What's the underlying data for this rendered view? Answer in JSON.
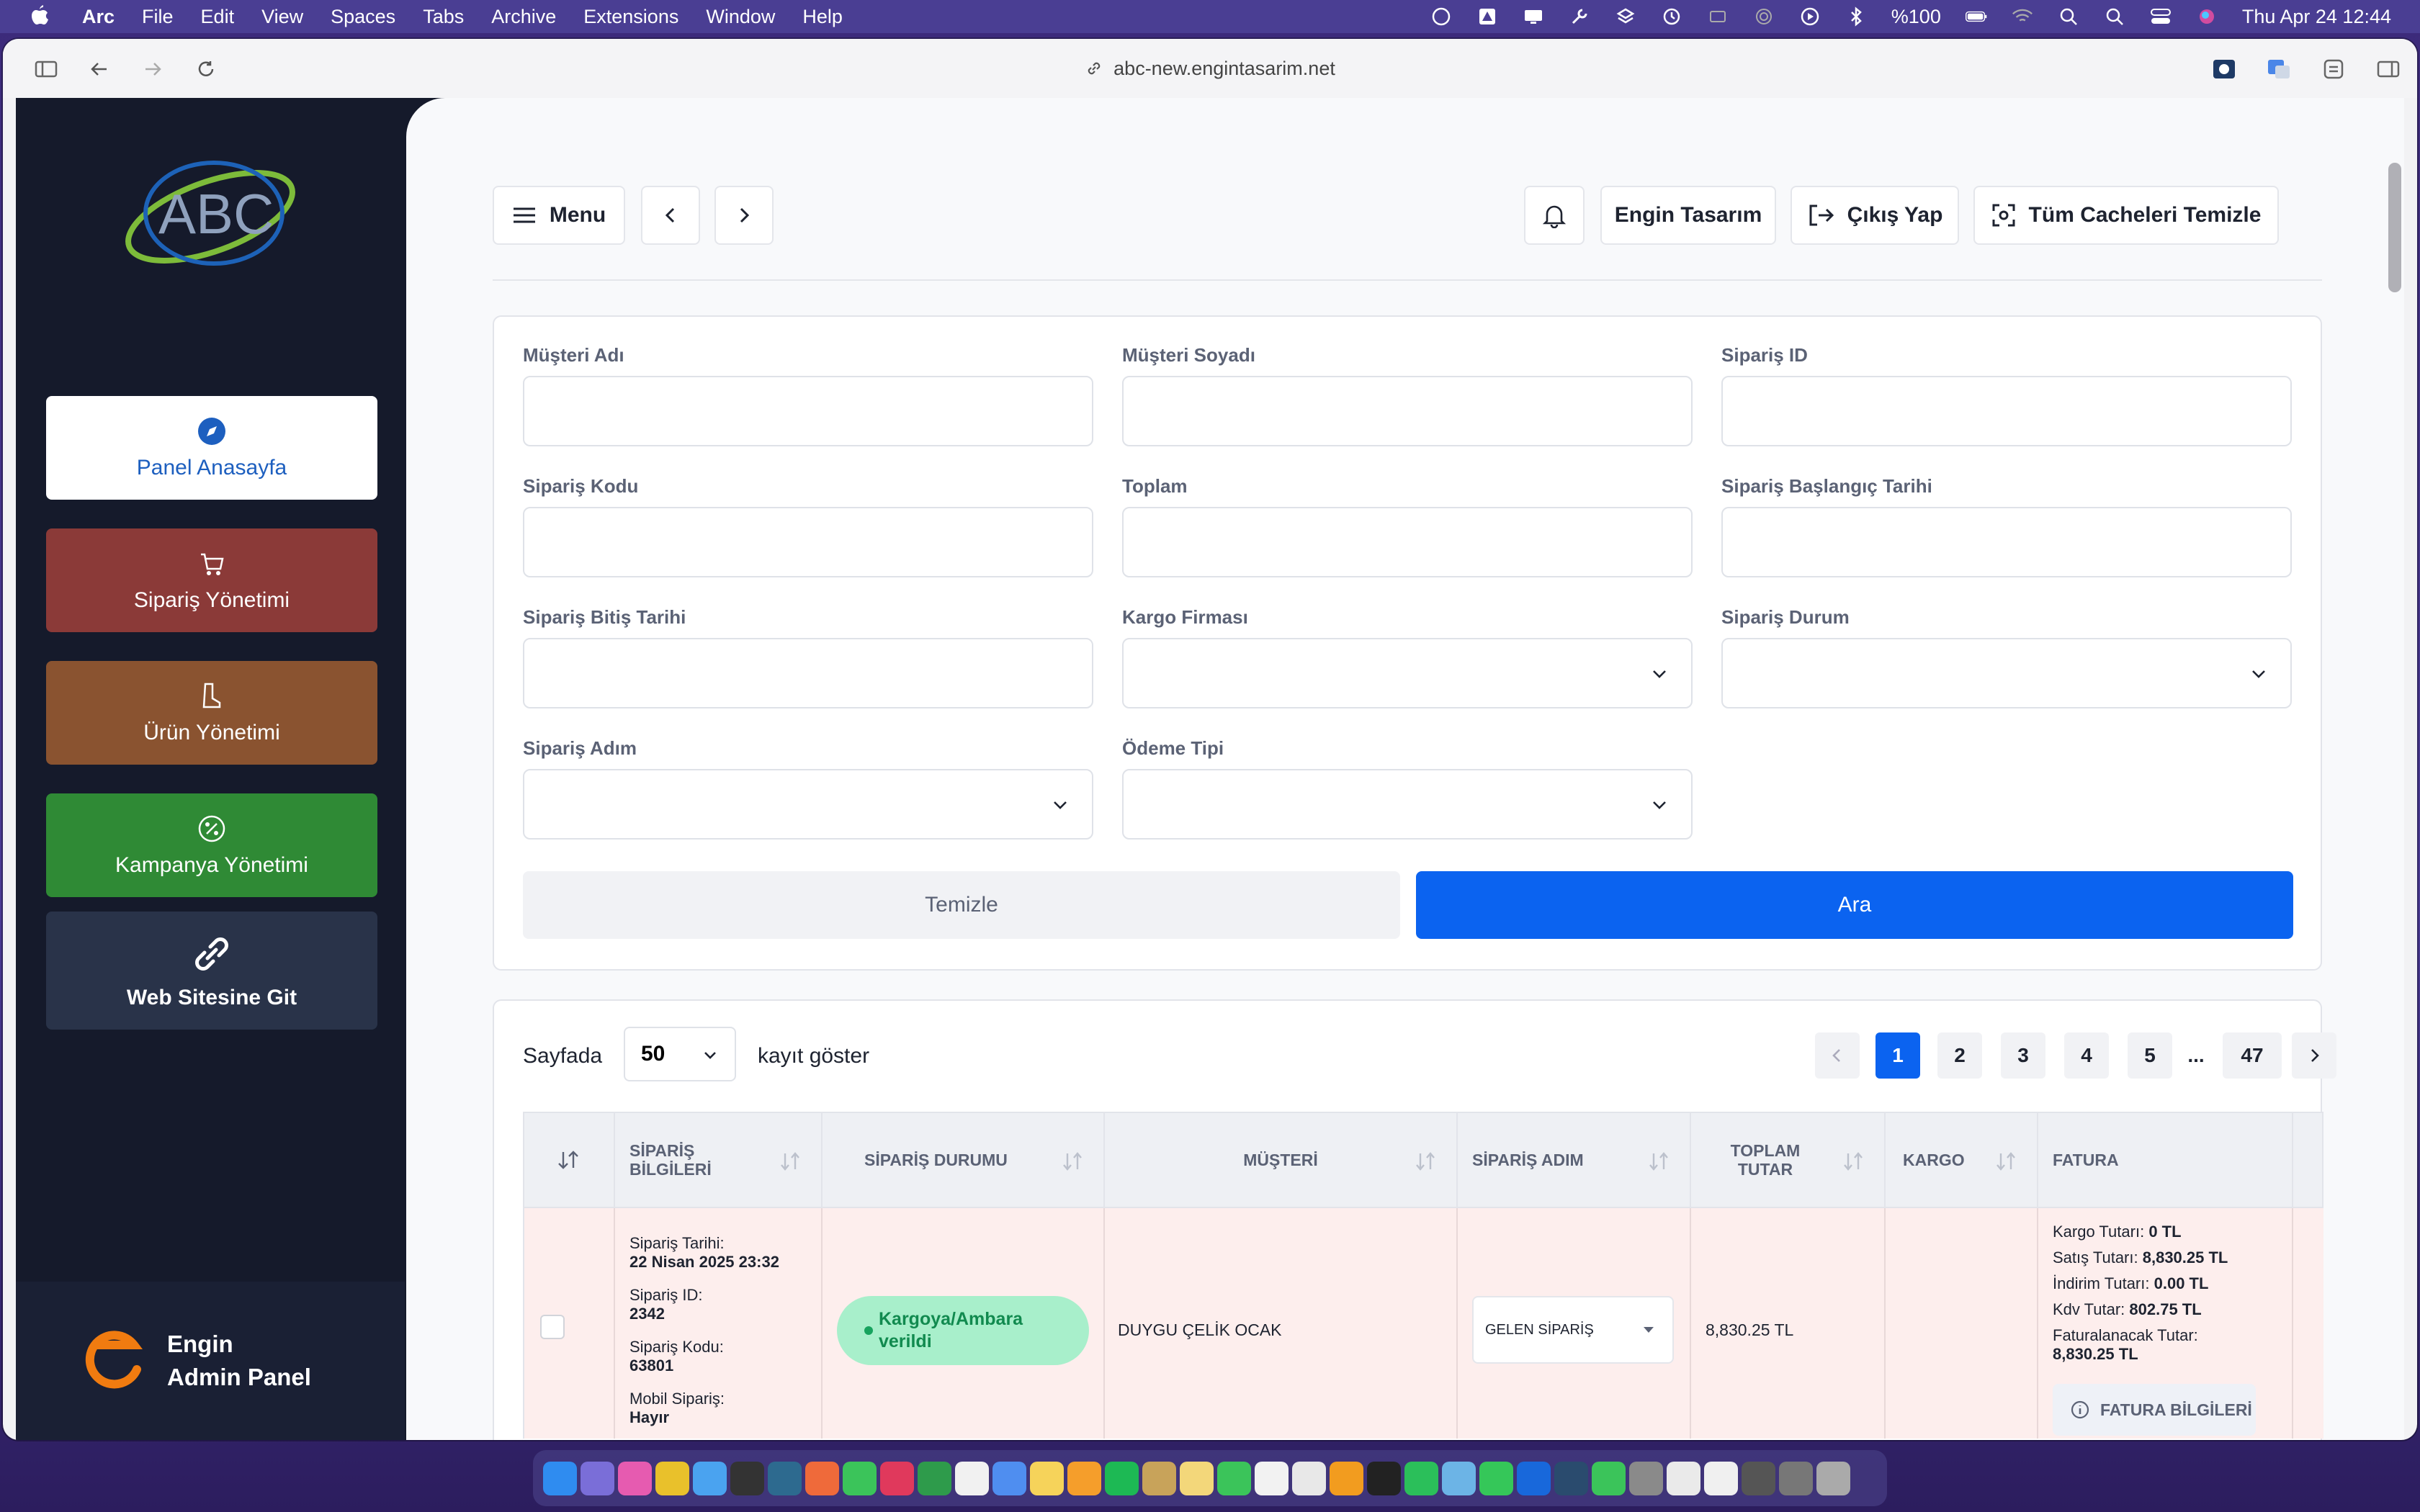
{
  "menubar": {
    "app": "Arc",
    "items": [
      "File",
      "Edit",
      "View",
      "Spaces",
      "Tabs",
      "Archive",
      "Extensions",
      "Window",
      "Help"
    ],
    "battery": "%100",
    "clock": "Thu Apr 24  12:44"
  },
  "browser": {
    "url": "abc-new.engintasarim.net"
  },
  "sidebar": {
    "items": [
      {
        "label": "Panel Anasayfa",
        "icon": "compass-icon",
        "color": "#ffffff",
        "text_color": "#1d5fbf"
      },
      {
        "label": "Sipariş Yönetimi",
        "icon": "cart-icon",
        "color": "#8b3a38",
        "text_color": "#ffffff"
      },
      {
        "label": "Ürün Yönetimi",
        "icon": "boot-icon",
        "color": "#8a5330",
        "text_color": "#ffffff"
      },
      {
        "label": "Kampanya Yönetimi",
        "icon": "discount-icon",
        "color": "#2f8a35",
        "text_color": "#ffffff"
      },
      {
        "label": "Web Sitesine Git",
        "icon": "link-icon",
        "color": "#293349",
        "text_color": "#ffffff"
      }
    ],
    "footer": {
      "line1": "Engin",
      "line2": "Admin Panel"
    }
  },
  "topbar": {
    "menu_label": "Menu",
    "user_label": "Engin Tasarım",
    "logout_label": "Çıkış Yap",
    "clear_cache_label": "Tüm Cacheleri Temizle"
  },
  "filters": {
    "fields": [
      {
        "label": "Müşteri Adı",
        "type": "text",
        "value": ""
      },
      {
        "label": "Müşteri Soyadı",
        "type": "text",
        "value": ""
      },
      {
        "label": "Sipariş ID",
        "type": "text",
        "value": ""
      },
      {
        "label": "Sipariş Kodu",
        "type": "text",
        "value": ""
      },
      {
        "label": "Toplam",
        "type": "text",
        "value": ""
      },
      {
        "label": "Sipariş Başlangıç Tarihi",
        "type": "text",
        "value": ""
      },
      {
        "label": "Sipariş Bitiş Tarihi",
        "type": "text",
        "value": ""
      },
      {
        "label": "Kargo Firması",
        "type": "select",
        "value": ""
      },
      {
        "label": "Sipariş Durum",
        "type": "select",
        "value": ""
      },
      {
        "label": "Sipariş Adım",
        "type": "select",
        "value": ""
      },
      {
        "label": "Ödeme Tipi",
        "type": "select",
        "value": ""
      }
    ],
    "clear_label": "Temizle",
    "search_label": "Ara"
  },
  "table": {
    "page_prefix": "Sayfada",
    "page_size": "50",
    "page_suffix": "kayıt göster",
    "pages": [
      "1",
      "2",
      "3",
      "4",
      "5",
      "...",
      "47"
    ],
    "current_page": "1",
    "columns": [
      "SİPARİŞ BİLGİLERİ",
      "SİPARİŞ DURUMU",
      "MÜŞTERİ",
      "SİPARİŞ ADIM",
      "TOPLAM TUTAR",
      "KARGO",
      "FATURA"
    ],
    "rows": [
      {
        "date_label": "Sipariş Tarihi:",
        "date": "22 Nisan 2025 23:32",
        "id_label": "Sipariş ID:",
        "id": "2342",
        "code_label": "Sipariş Kodu:",
        "code": "63801",
        "mobile_label": "Mobil Sipariş:",
        "mobile": "Hayır",
        "status": "Kargoya/Ambara verildi",
        "customer": "DUYGU ÇELİK OCAK",
        "step": "GELEN SİPARİŞ",
        "total": "8,830.25 TL",
        "kargo_tutar_label": "Kargo Tutarı:",
        "kargo_tutar": "0 TL",
        "satis_tutar_label": "Satış Tutarı:",
        "satis_tutar": "8,830.25 TL",
        "indirim_label": "İndirim Tutarı:",
        "indirim": "0.00 TL",
        "kdv_label": "Kdv Tutar:",
        "kdv": "802.75 TL",
        "faturalanacak_label": "Faturalanacak Tutar:",
        "faturalanacak": "8,830.25 TL",
        "fatura_button": "FATURA BİLGİLERİ"
      }
    ]
  },
  "colors": {
    "accent": "#0b63f0",
    "row_bg": "#fdeeed",
    "badge_bg": "#a8efcb"
  }
}
